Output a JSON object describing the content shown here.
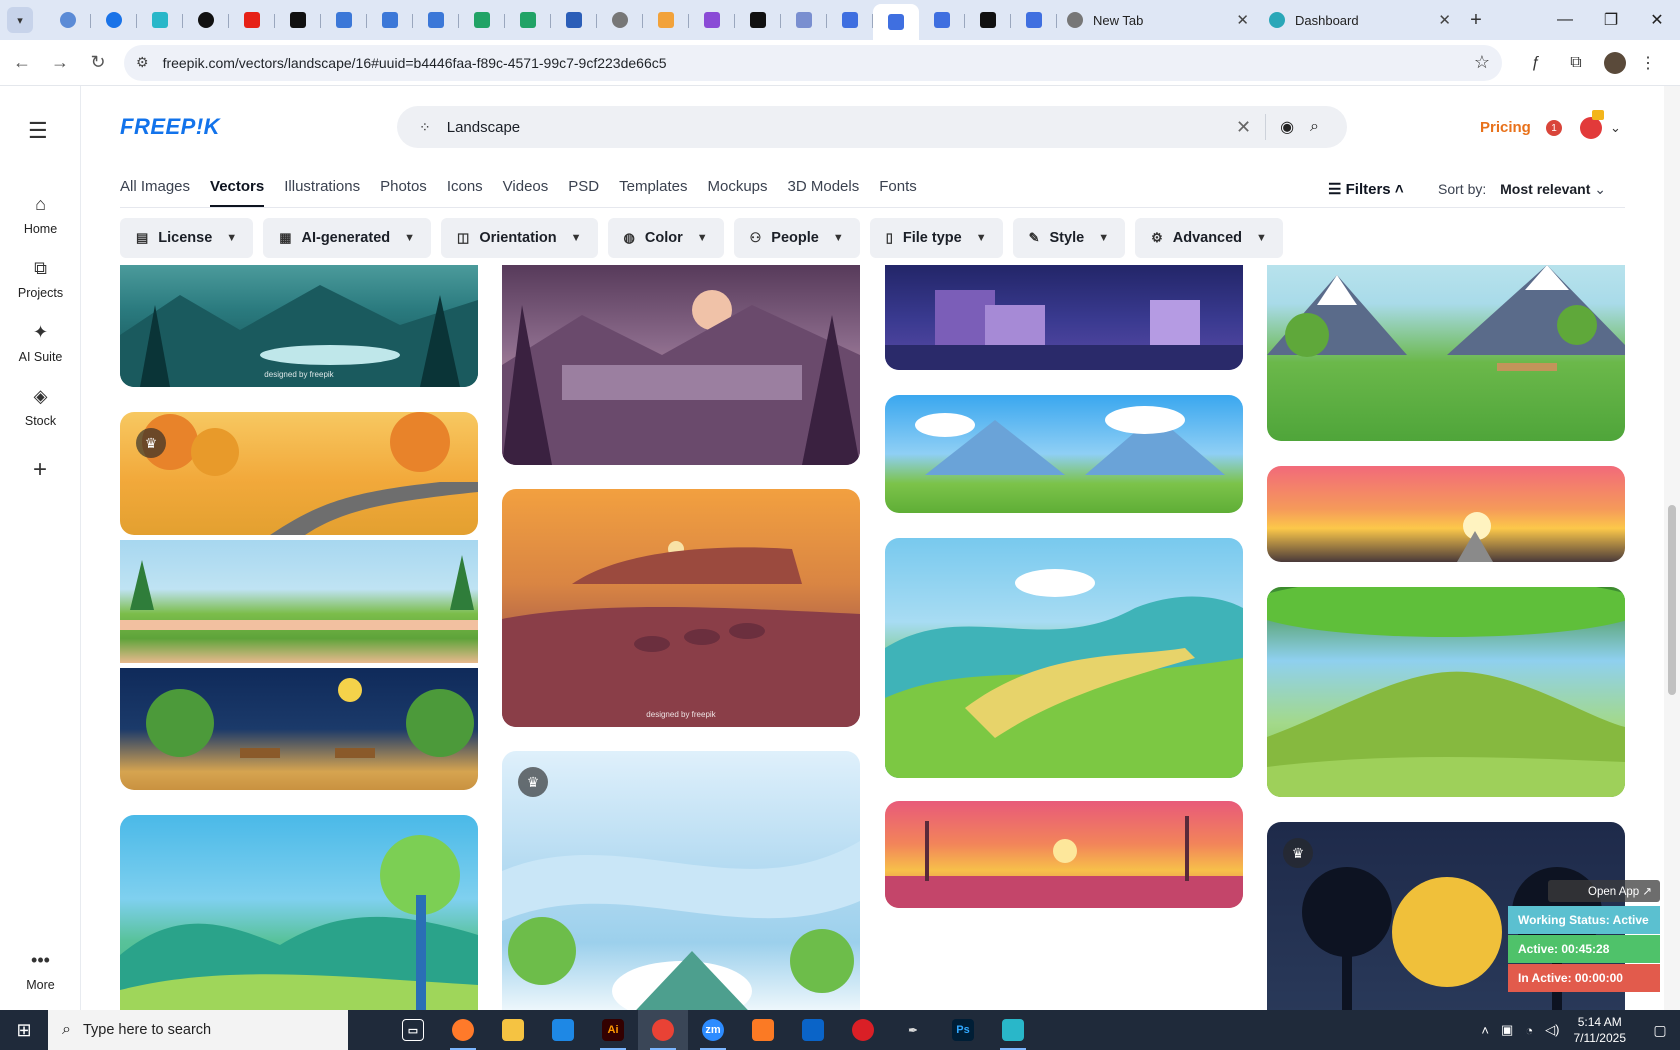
{
  "browser": {
    "tabs": [
      {
        "title": "New Tab"
      },
      {
        "title": "Dashboard"
      }
    ],
    "pinned_icons": [
      "globe-icon",
      "vpn-shield-icon",
      "arrow-app-icon",
      "openai-icon",
      "youtube-icon",
      "bolt-icon",
      "docs-icon",
      "docs-icon",
      "docs-icon",
      "sheets-icon",
      "sheets-icon",
      "word-icon",
      "globe-icon",
      "fox-icon",
      "brackets-icon",
      "ai-letter-icon",
      "grid-app-icon",
      "forms-icon",
      "forms-icon",
      "forms-icon",
      "medium-icon",
      "forms-icon"
    ],
    "url": "freepik.com/vectors/landscape/16#uuid=b4446faa-f89c-4571-99c7-9cf223de66c5"
  },
  "sidebar": {
    "items": [
      {
        "label": "Home",
        "icon": "home-icon"
      },
      {
        "label": "Projects",
        "icon": "projects-icon"
      },
      {
        "label": "AI Suite",
        "icon": "sparkle-icon"
      },
      {
        "label": "Stock",
        "icon": "stock-icon"
      }
    ],
    "more_label": "More"
  },
  "header": {
    "logo": "FREEP!K",
    "search_value": "Landscape",
    "pricing": "Pricing",
    "notification_count": "1"
  },
  "categories": [
    "All Images",
    "Vectors",
    "Illustrations",
    "Photos",
    "Icons",
    "Videos",
    "PSD",
    "Templates",
    "Mockups",
    "3D Models",
    "Fonts"
  ],
  "active_category": "Vectors",
  "filters_label": "Filters",
  "sort": {
    "label": "Sort by:",
    "value": "Most relevant"
  },
  "chips": [
    {
      "label": "License",
      "icon": "license-icon"
    },
    {
      "label": "AI-generated",
      "icon": "ai-icon"
    },
    {
      "label": "Orientation",
      "icon": "orientation-icon"
    },
    {
      "label": "Color",
      "icon": "palette-icon"
    },
    {
      "label": "People",
      "icon": "people-icon"
    },
    {
      "label": "File type",
      "icon": "file-icon"
    },
    {
      "label": "Style",
      "icon": "brush-icon"
    },
    {
      "label": "Advanced",
      "icon": "gear-icon"
    }
  ],
  "gallery_watermark": "designed by freepik",
  "work_status": {
    "open_app": "Open App ↗",
    "status": "Working Status: Active",
    "active": "Active: 00:45:28",
    "inactive": "In Active: 00:00:00"
  },
  "taskbar": {
    "search_placeholder": "Type here to search",
    "time": "5:14 AM",
    "date": "7/11/2025"
  },
  "colors": {
    "brand": "#1273eb",
    "pricing": "#e8711a",
    "status_active_bg": "#5bc0d0",
    "active_bg": "#4fc26a",
    "inactive_bg": "#e25b4c"
  }
}
